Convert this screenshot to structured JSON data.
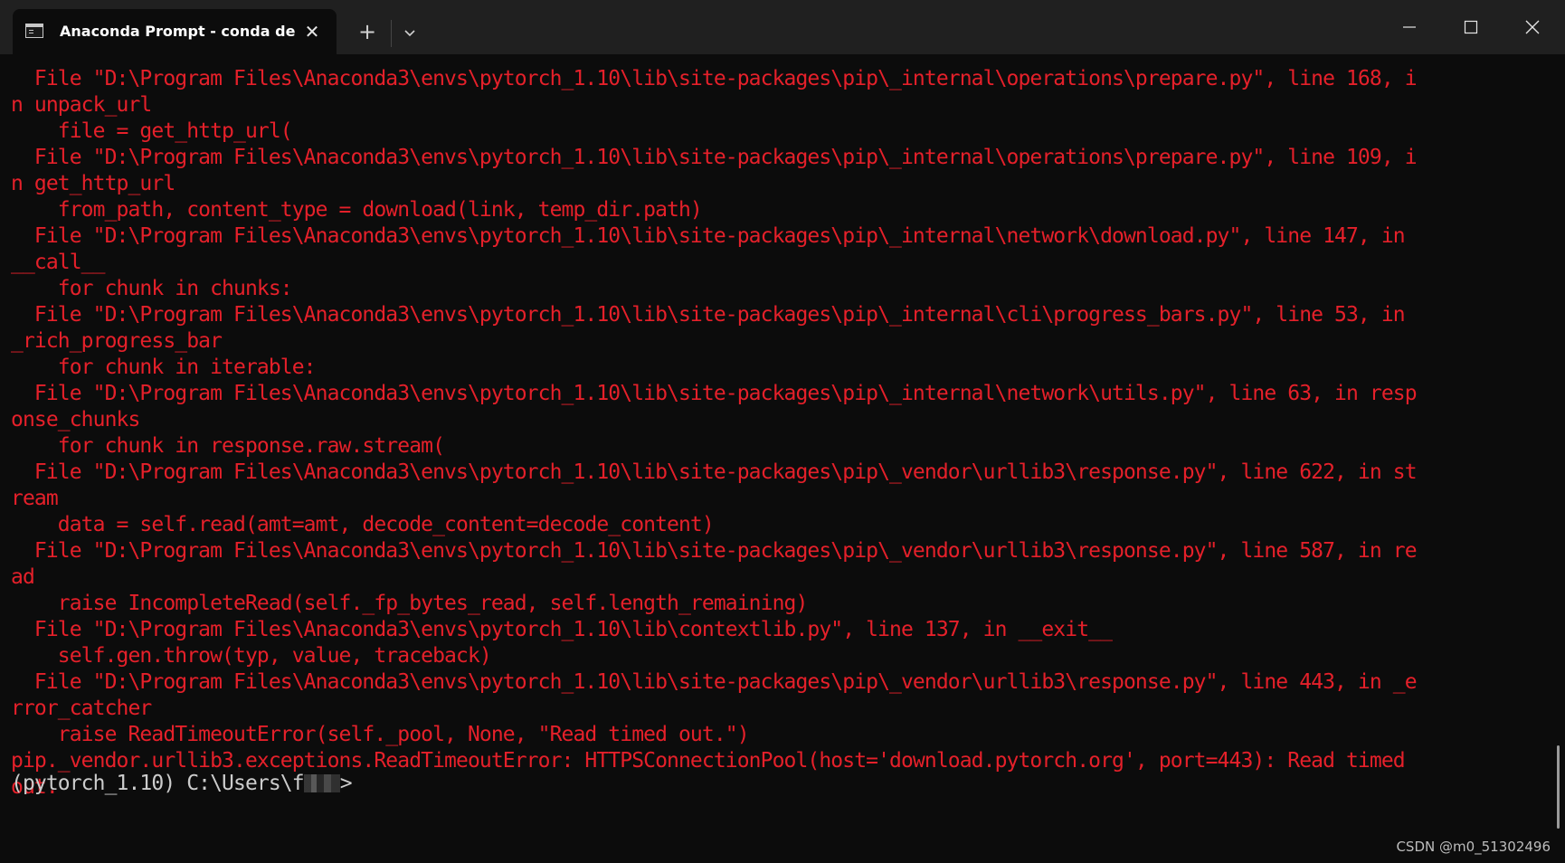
{
  "titlebar": {
    "tab_title": "Anaconda Prompt - conda  de",
    "icons": {
      "tab": "terminal-icon",
      "close_tab": "close-icon",
      "new_tab": "plus-icon",
      "dropdown": "chevron-down-icon",
      "minimize": "minimize-icon",
      "maximize": "maximize-icon",
      "close_window": "close-icon"
    }
  },
  "terminal": {
    "colors": {
      "background": "#0c0c0c",
      "error_text": "#e5202a",
      "prompt_text": "#cccccc"
    },
    "lines": [
      "  File \"D:\\Program Files\\Anaconda3\\envs\\pytorch_1.10\\lib\\site-packages\\pip\\_internal\\operations\\prepare.py\", line 168, i",
      "n unpack_url",
      "    file = get_http_url(",
      "  File \"D:\\Program Files\\Anaconda3\\envs\\pytorch_1.10\\lib\\site-packages\\pip\\_internal\\operations\\prepare.py\", line 109, i",
      "n get_http_url",
      "    from_path, content_type = download(link, temp_dir.path)",
      "  File \"D:\\Program Files\\Anaconda3\\envs\\pytorch_1.10\\lib\\site-packages\\pip\\_internal\\network\\download.py\", line 147, in",
      "__call__",
      "    for chunk in chunks:",
      "  File \"D:\\Program Files\\Anaconda3\\envs\\pytorch_1.10\\lib\\site-packages\\pip\\_internal\\cli\\progress_bars.py\", line 53, in",
      "_rich_progress_bar",
      "    for chunk in iterable:",
      "  File \"D:\\Program Files\\Anaconda3\\envs\\pytorch_1.10\\lib\\site-packages\\pip\\_internal\\network\\utils.py\", line 63, in resp",
      "onse_chunks",
      "    for chunk in response.raw.stream(",
      "  File \"D:\\Program Files\\Anaconda3\\envs\\pytorch_1.10\\lib\\site-packages\\pip\\_vendor\\urllib3\\response.py\", line 622, in st",
      "ream",
      "    data = self.read(amt=amt, decode_content=decode_content)",
      "  File \"D:\\Program Files\\Anaconda3\\envs\\pytorch_1.10\\lib\\site-packages\\pip\\_vendor\\urllib3\\response.py\", line 587, in re",
      "ad",
      "    raise IncompleteRead(self._fp_bytes_read, self.length_remaining)",
      "  File \"D:\\Program Files\\Anaconda3\\envs\\pytorch_1.10\\lib\\contextlib.py\", line 137, in __exit__",
      "    self.gen.throw(typ, value, traceback)",
      "  File \"D:\\Program Files\\Anaconda3\\envs\\pytorch_1.10\\lib\\site-packages\\pip\\_vendor\\urllib3\\response.py\", line 443, in _e",
      "rror_catcher",
      "    raise ReadTimeoutError(self._pool, None, \"Read timed out.\")",
      "pip._vendor.urllib3.exceptions.ReadTimeoutError: HTTPSConnectionPool(host='download.pytorch.org', port=443): Read timed",
      "out."
    ],
    "prompt": {
      "prefix": "(pytorch_1.10) C:\\Users\\",
      "visible_char": "f",
      "suffix": ">"
    }
  },
  "watermark": "CSDN @m0_51302496"
}
